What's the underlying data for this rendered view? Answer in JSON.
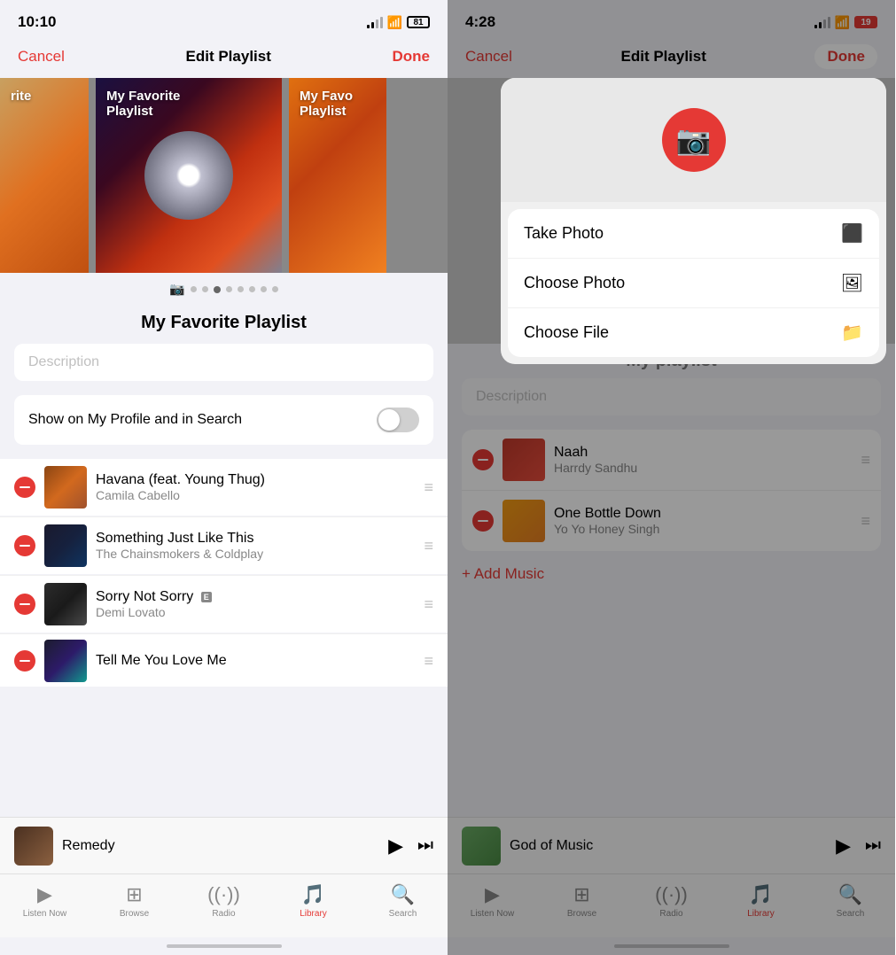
{
  "left": {
    "status": {
      "time": "10:10",
      "battery": "81"
    },
    "nav": {
      "cancel": "Cancel",
      "title": "Edit Playlist",
      "done": "Done"
    },
    "artwork": {
      "items": [
        {
          "type": "partial-left",
          "label": "rite"
        },
        {
          "type": "center",
          "label": "My Favorite\nPlaylist"
        },
        {
          "type": "partial-right",
          "label": "My Favo\nPlaylist"
        }
      ]
    },
    "playlist_name": "My Favorite Playlist",
    "description_placeholder": "Description",
    "show_profile_label": "Show on My Profile and in Search",
    "songs": [
      {
        "title": "Havana (feat. Young Thug)",
        "artist": "Camila Cabello",
        "explicit": false
      },
      {
        "title": "Something Just Like This",
        "artist": "The Chainsmokers & Coldplay",
        "explicit": false
      },
      {
        "title": "Sorry Not Sorry",
        "artist": "Demi Lovato",
        "explicit": true
      },
      {
        "title": "Tell Me You Love Me",
        "artist": "",
        "explicit": false
      }
    ],
    "player": {
      "title": "Remedy",
      "play_btn": "▶",
      "skip_btn": "⏭"
    },
    "tabs": [
      {
        "label": "Listen Now",
        "icon": "▶",
        "active": false
      },
      {
        "label": "Browse",
        "icon": "⊞",
        "active": false
      },
      {
        "label": "Radio",
        "icon": "📡",
        "active": false
      },
      {
        "label": "Library",
        "icon": "📚",
        "active": true
      },
      {
        "label": "Search",
        "icon": "🔍",
        "active": false
      }
    ]
  },
  "right": {
    "status": {
      "time": "4:28",
      "battery": "19"
    },
    "nav": {
      "cancel": "Cancel",
      "title": "Edit Playlist",
      "done": "Done"
    },
    "popup": {
      "menu_items": [
        {
          "label": "Take Photo",
          "icon": "📷"
        },
        {
          "label": "Choose Photo",
          "icon": "🖼"
        },
        {
          "label": "Choose File",
          "icon": "📁"
        }
      ]
    },
    "playlist_name": "My playlist",
    "description_placeholder": "Description",
    "songs": [
      {
        "title": "Naah",
        "artist": "Harrdy Sandhu"
      },
      {
        "title": "One Bottle Down",
        "artist": "Yo Yo Honey Singh"
      }
    ],
    "add_music": "+ Add Music",
    "player": {
      "title": "God of Music",
      "play_btn": "▶",
      "skip_btn": "⏭"
    },
    "tabs": [
      {
        "label": "Listen Now",
        "icon": "▶",
        "active": false
      },
      {
        "label": "Browse",
        "icon": "⊞",
        "active": false
      },
      {
        "label": "Radio",
        "icon": "📡",
        "active": false
      },
      {
        "label": "Library",
        "icon": "📚",
        "active": true
      },
      {
        "label": "Search",
        "icon": "🔍",
        "active": false
      }
    ]
  }
}
